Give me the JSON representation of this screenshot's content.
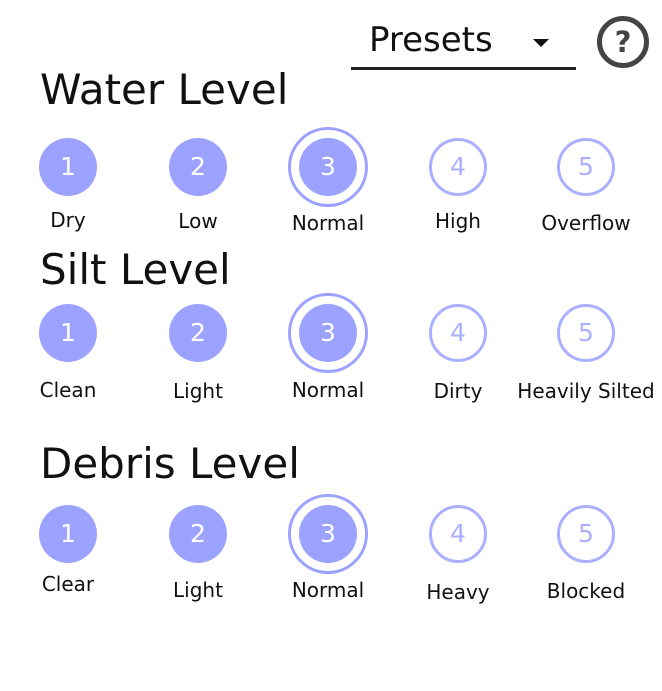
{
  "presets": {
    "label": "Presets",
    "caret_icon": "caret-down-icon"
  },
  "help": {
    "glyph": "?",
    "icon": "help-icon"
  },
  "colors": {
    "accent": "#9ca2ff",
    "outline": "#aab0ff",
    "text": "#111111"
  },
  "water": {
    "title": "Water Level",
    "selected": 3,
    "options": [
      {
        "num": "1",
        "label": "Dry"
      },
      {
        "num": "2",
        "label": "Low"
      },
      {
        "num": "3",
        "label": "Normal"
      },
      {
        "num": "4",
        "label": "High"
      },
      {
        "num": "5",
        "label": "Overflow"
      }
    ]
  },
  "silt": {
    "title": "Silt Level",
    "selected": 3,
    "options": [
      {
        "num": "1",
        "label": "Clean"
      },
      {
        "num": "2",
        "label": "Light"
      },
      {
        "num": "3",
        "label": "Normal"
      },
      {
        "num": "4",
        "label": "Dirty"
      },
      {
        "num": "5",
        "label": "Heavily Silted"
      }
    ]
  },
  "debris": {
    "title": "Debris Level",
    "selected": 3,
    "options": [
      {
        "num": "1",
        "label": "Clear"
      },
      {
        "num": "2",
        "label": "Light"
      },
      {
        "num": "3",
        "label": "Normal"
      },
      {
        "num": "4",
        "label": "Heavy"
      },
      {
        "num": "5",
        "label": "Blocked"
      }
    ]
  }
}
